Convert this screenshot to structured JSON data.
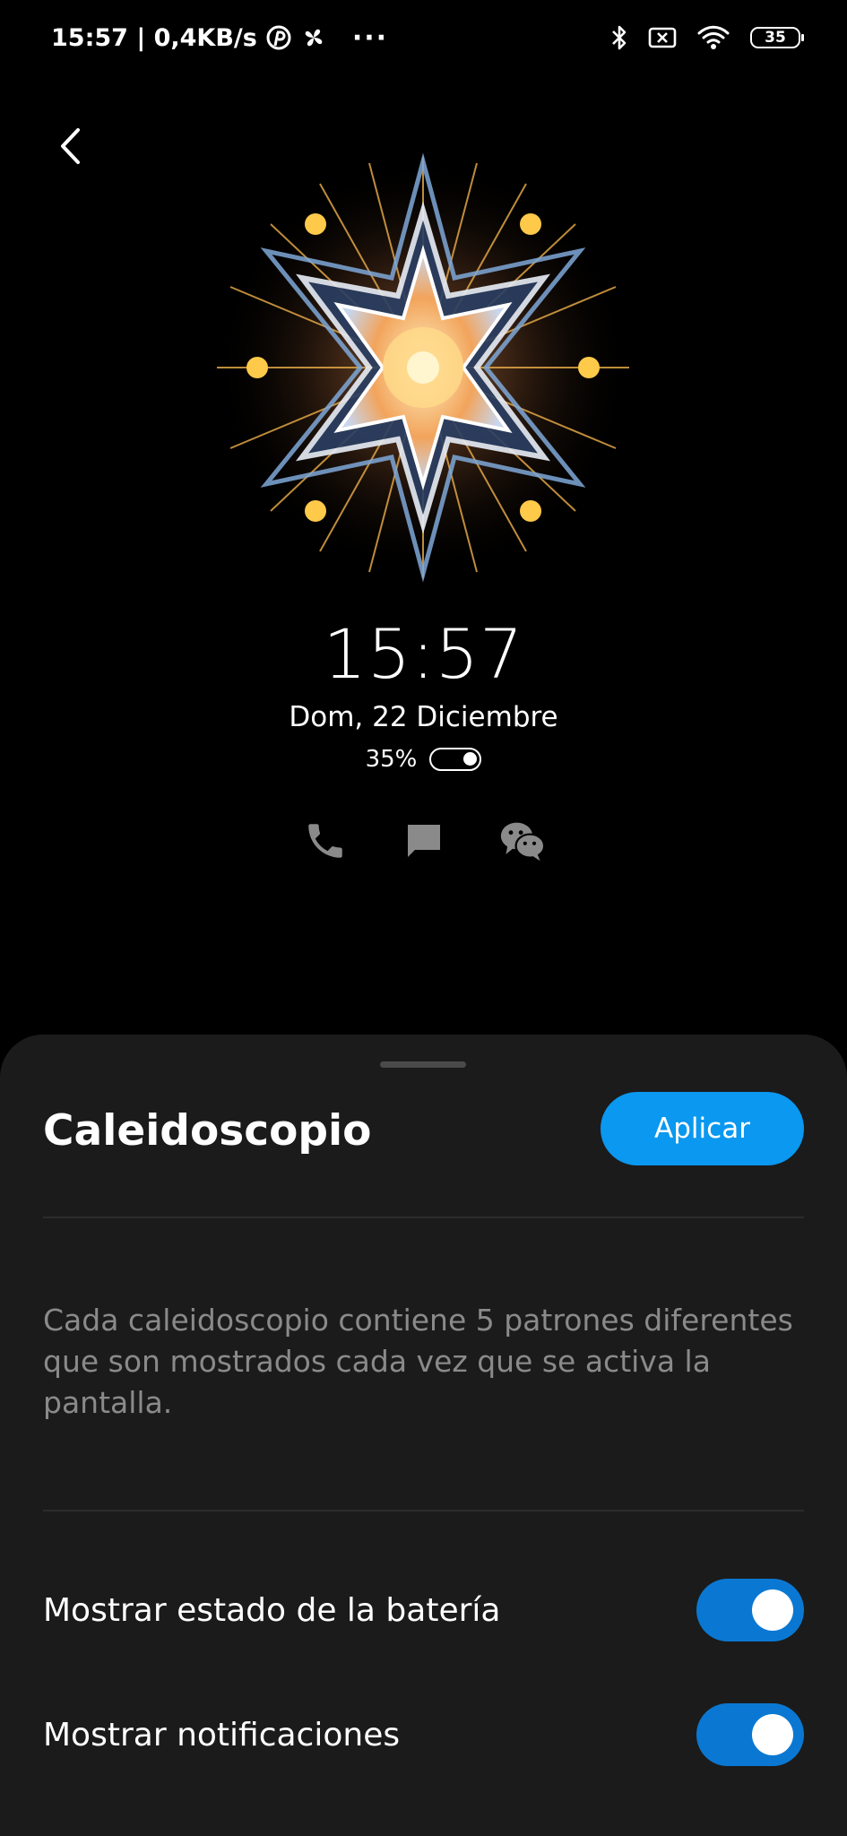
{
  "status_bar": {
    "time_speed": "15:57 | 0,4KB/s",
    "more": "···",
    "battery": "35",
    "icons": [
      "pinterest-icon",
      "fan-icon",
      "bluetooth-icon",
      "sim-off-icon",
      "wifi-icon",
      "battery-icon"
    ]
  },
  "preview": {
    "clock": "15:57",
    "date": "Dom, 22 Diciembre",
    "battery_percent": "35%",
    "notification_icons": [
      "phone-icon",
      "message-icon",
      "wechat-icon"
    ]
  },
  "sheet": {
    "title": "Caleidoscopio",
    "apply_label": "Aplicar",
    "description": "Cada caleidoscopio contiene 5 patrones diferentes que son mostrados cada vez que se activa la pantalla.",
    "settings": [
      {
        "label": "Mostrar estado de la batería",
        "enabled": true
      },
      {
        "label": "Mostrar notificaciones",
        "enabled": true
      }
    ]
  },
  "colors": {
    "accent": "#0a98f0",
    "toggle_on": "#0a78d2",
    "sheet_bg": "#1b1b1b",
    "description_text": "#8a8a8a"
  }
}
